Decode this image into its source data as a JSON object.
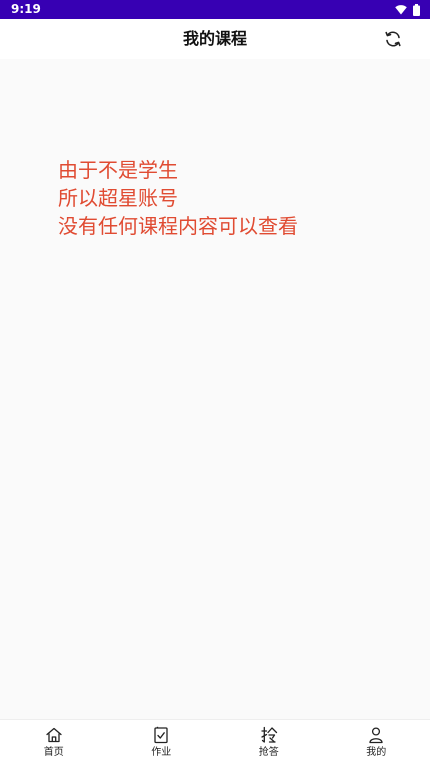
{
  "status_bar": {
    "time": "9:19",
    "color": "#3700b3"
  },
  "app_bar": {
    "title": "我的课程",
    "refresh_icon": "refresh-icon"
  },
  "message": {
    "lines": [
      "由于不是学生",
      "所以超星账号",
      "没有任何课程内容可以查看"
    ],
    "color": "#e04b32"
  },
  "bottom_nav": {
    "items": [
      {
        "label": "首页",
        "icon": "home-icon"
      },
      {
        "label": "作业",
        "icon": "homework-icon"
      },
      {
        "label": "抢答",
        "icon": "quick-answer-icon"
      },
      {
        "label": "我的",
        "icon": "profile-icon"
      }
    ]
  }
}
